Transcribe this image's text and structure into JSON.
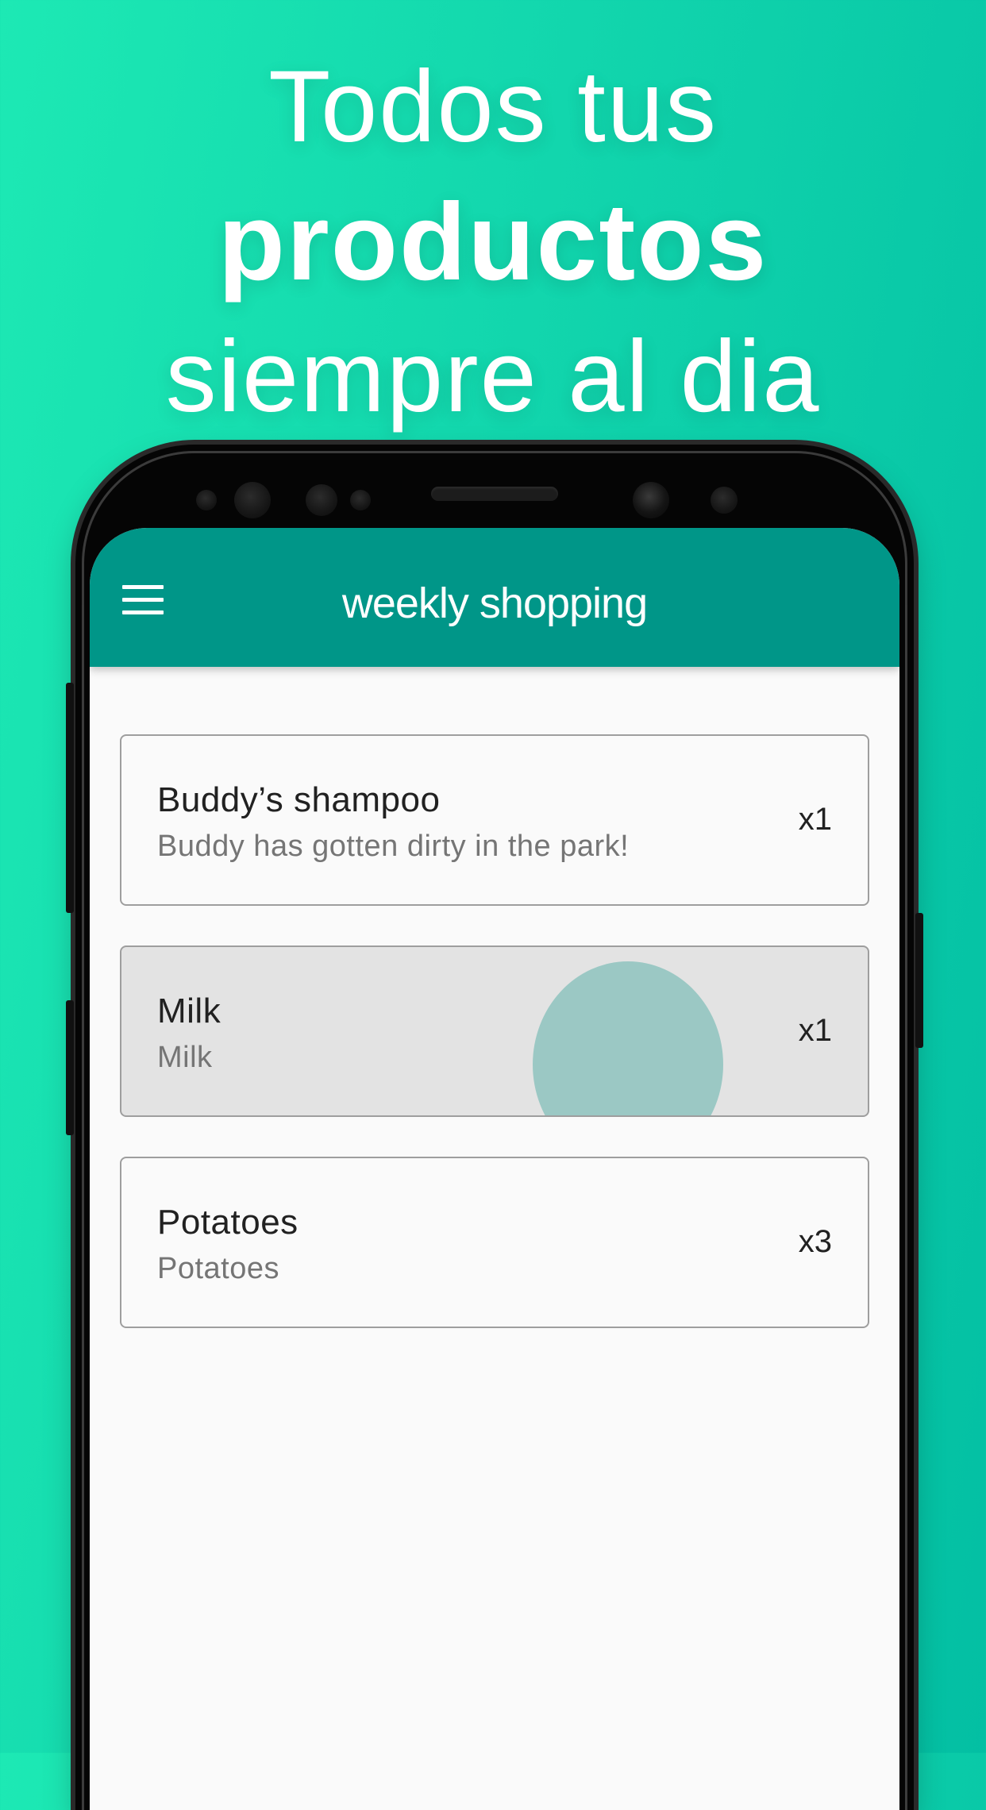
{
  "promo": {
    "line1": "Todos tus",
    "line2": "productos",
    "line3": "siempre al dia"
  },
  "app_bar": {
    "menu_icon": "menu-icon",
    "title": "weekly shopping"
  },
  "colors": {
    "background_gradient_start": "#1de9b4",
    "background_gradient_end": "#03bfa3",
    "app_bar": "#009688",
    "ripple": "#9bc8c4",
    "pressed_item": "#e3e3e3"
  },
  "items": [
    {
      "name": "Buddy’s shampoo",
      "description": "Buddy has gotten dirty in the park!",
      "quantity": "x1",
      "pressed": false
    },
    {
      "name": "Milk",
      "description": "Milk",
      "quantity": "x1",
      "pressed": true
    },
    {
      "name": "Potatoes",
      "description": "Potatoes",
      "quantity": "x3",
      "pressed": false
    }
  ]
}
